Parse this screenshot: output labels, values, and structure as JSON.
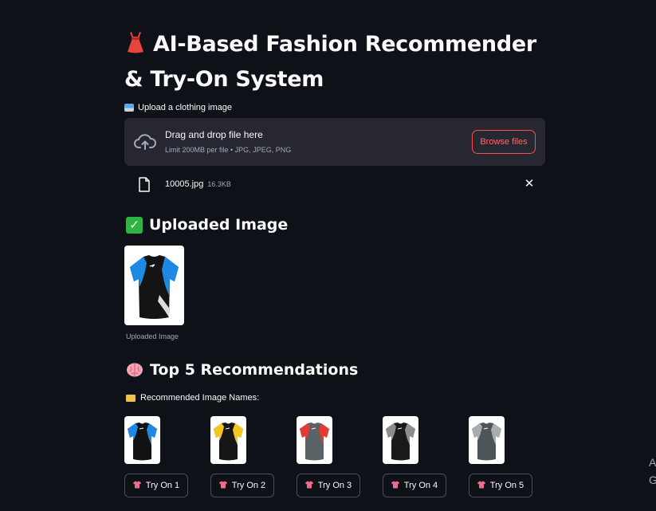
{
  "header": {
    "title_icon": "dress-icon",
    "title": "AI-Based Fashion Recommender & Try-On System"
  },
  "uploader": {
    "label": "Upload a clothing image",
    "label_icon": "inbox-tray-icon",
    "drop_title": "Drag and drop file here",
    "drop_subtitle": "Limit 200MB per file • JPG, JPEG, PNG",
    "browse_label": "Browse files",
    "file": {
      "name": "10005.jpg",
      "size": "16.3KB"
    }
  },
  "uploaded": {
    "heading": "Uploaded Image",
    "heading_icon": "check-mark-icon",
    "caption": "Uploaded Image"
  },
  "recommendations": {
    "heading": "Top 5 Recommendations",
    "heading_icon": "brain-icon",
    "names_label": "Recommended Image Names:",
    "names_icon": "folder-icon",
    "items": [
      {
        "button": "Try On 1",
        "body": "#121212",
        "accent": "#1e88e5"
      },
      {
        "button": "Try On 2",
        "body": "#161616",
        "accent": "#f2c81e"
      },
      {
        "button": "Try On 3",
        "body": "#5b6266",
        "accent": "#e53935"
      },
      {
        "button": "Try On 4",
        "body": "#1a1a1a",
        "accent": "#8d8d8d"
      },
      {
        "button": "Try On 5",
        "body": "#4e5558",
        "accent": "#a8adb0"
      }
    ]
  },
  "side_cutoff": {
    "line1": "A",
    "line2": "G"
  },
  "colors": {
    "background": "#0e1117",
    "surface": "#262730",
    "primary": "#ff4b4b",
    "muted_text": "#a3a8b8"
  }
}
